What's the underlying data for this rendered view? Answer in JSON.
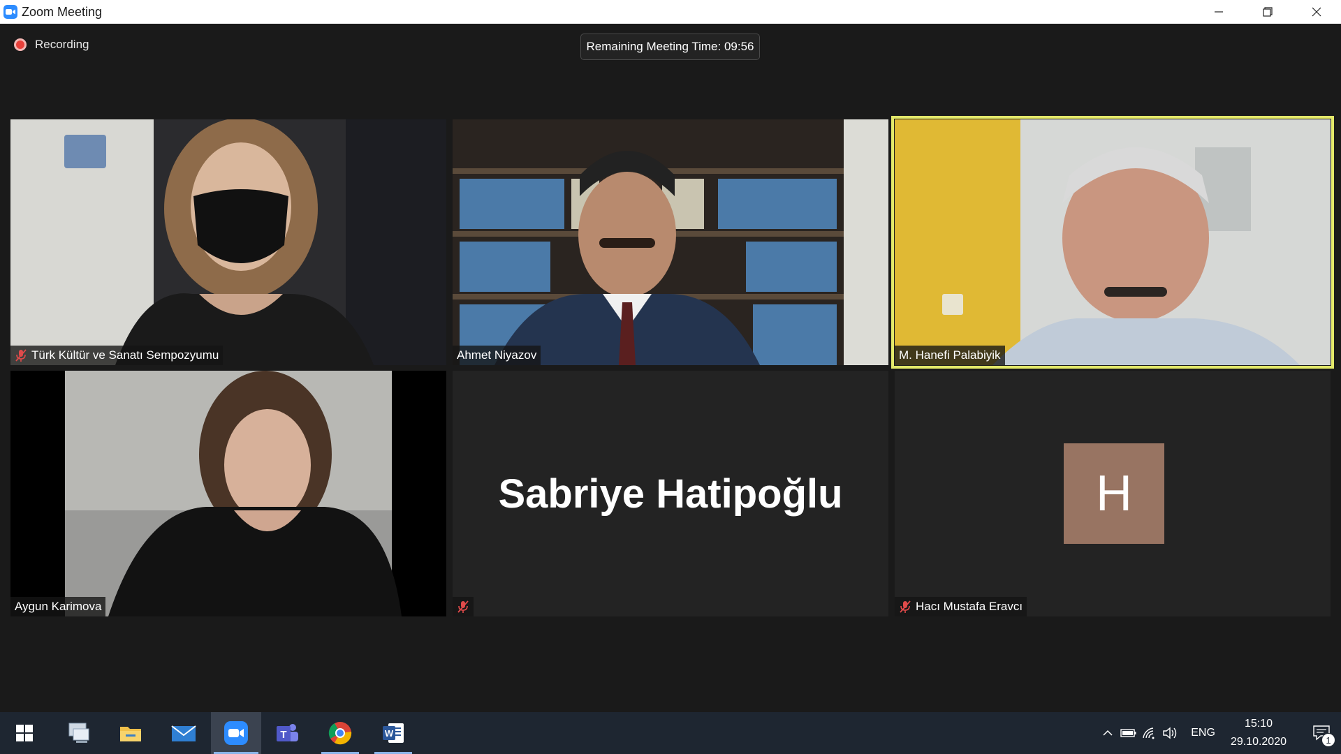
{
  "window": {
    "title": "Zoom Meeting"
  },
  "meeting": {
    "recording_label": "Recording",
    "remaining_time": "Remaining Meeting Time: 09:56",
    "participants": [
      {
        "name": "Türk Kültür ve Sanatı Sempozyumu",
        "muted": true
      },
      {
        "name": "Ahmet Niyazov",
        "muted": false
      },
      {
        "name": "M. Hanefi Palabiyik",
        "muted": false,
        "active_speaker": true
      },
      {
        "name": "Aygun Karimova",
        "muted": false
      },
      {
        "name": "Sabriye Hatipoğlu",
        "muted": true,
        "video_off": true
      },
      {
        "name": "Hacı Mustafa Eravcı",
        "muted": true,
        "video_off": true,
        "avatar_letter": "H"
      }
    ]
  },
  "colors": {
    "active_speaker_border": "#e3e86a",
    "avatar_bg": "#987462",
    "recording_dot": "#e8403a",
    "zoom_blue": "#2d8cff"
  },
  "taskbar": {
    "apps": [
      "windows-start",
      "remote-desktop",
      "file-explorer",
      "mail",
      "zoom",
      "teams",
      "chrome",
      "word"
    ],
    "language": "ENG",
    "time": "15:10",
    "date": "29.10.2020",
    "notification_count": "1"
  }
}
